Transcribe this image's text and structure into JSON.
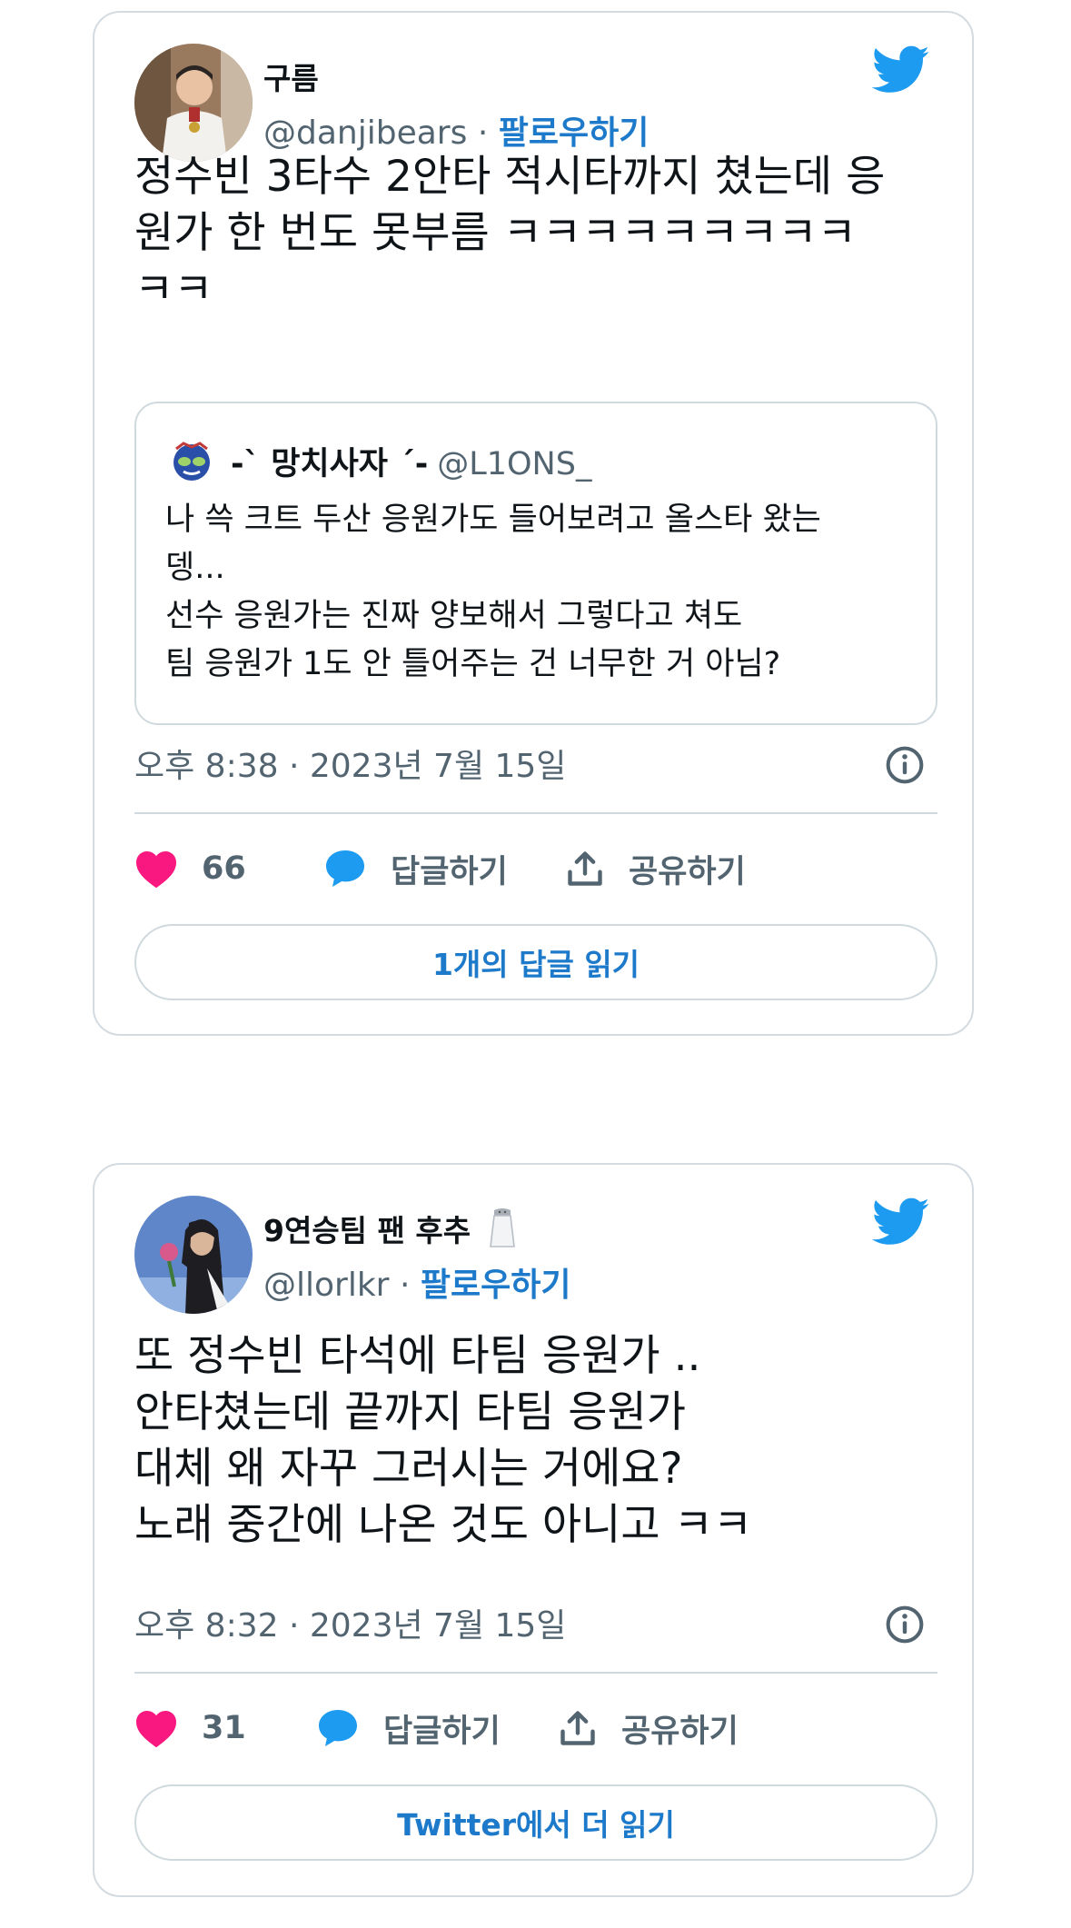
{
  "tweets": [
    {
      "name": "구름",
      "handle": "@danjibears",
      "separator": "·",
      "follow": "팔로우하기",
      "text_lines": [
        "정수빈 3타수 2안타 적시타까지 쳤는데 응",
        "원가 한 번도 못부름 ㅋㅋㅋㅋㅋㅋㅋㅋㅋ",
        "ㅋㅋ"
      ],
      "quote": {
        "name": "-` 망치사자 ´-",
        "handle": "@L1ONS_",
        "text_lines": [
          "나 쓱 크트 두산 응원가도 들어보려고 올스타 왔는",
          "뎅...",
          "선수 응원가는 진짜 양보해서 그렇다고 쳐도",
          "팀 응원가 1도 안 틀어주는 건 너무한 거 아님?"
        ]
      },
      "timestamp": "오후 8:38 · 2023년 7월 15일",
      "likes": "66",
      "reply_label": "답글하기",
      "share_label": "공유하기",
      "bottom_button": "1개의 답글 읽기"
    },
    {
      "name": "9연승팀 팬 후추",
      "handle": "@llorlkr",
      "separator": "·",
      "follow": "팔로우하기",
      "text_lines": [
        "또 정수빈 타석에 타팀 응원가 ..",
        "안타쳤는데 끝까지 타팀 응원가",
        "대체 왜 자꾸 그러시는 거에요?",
        "노래 중간에 나온 것도 아니고 ㅋㅋ"
      ],
      "timestamp": "오후 8:32 · 2023년 7월 15일",
      "likes": "31",
      "reply_label": "답글하기",
      "share_label": "공유하기",
      "bottom_button": "Twitter에서 더 읽기"
    }
  ],
  "icons": {
    "bird": "twitter-bird-icon",
    "heart": "heart-icon",
    "reply": "speech-bubble-icon",
    "share": "share-upload-icon",
    "info": "info-icon",
    "name_emoji": "salt-shaker-icon"
  },
  "colors": {
    "twitter_blue": "#1d9bf0",
    "link_blue": "#1d79c9",
    "heart_pink": "#f91880",
    "border": "#cfd9de",
    "secondary_text": "#536471"
  }
}
